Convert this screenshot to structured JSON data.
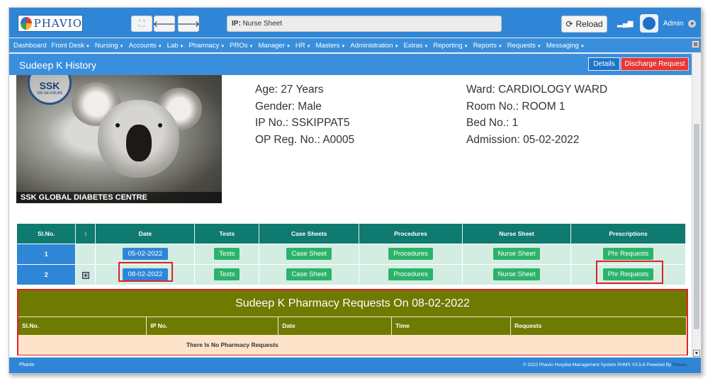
{
  "header": {
    "logo_text": "PHAVIO",
    "search_label": "IP:",
    "search_value": "Nurse Sheet",
    "reload_label": "Reload",
    "user_name": "Admin"
  },
  "menu": [
    {
      "label": "Dashboard",
      "caret": false
    },
    {
      "label": "Front Desk",
      "caret": true
    },
    {
      "label": "Nursing",
      "caret": true
    },
    {
      "label": "Accounts",
      "caret": true
    },
    {
      "label": "Lab",
      "caret": true
    },
    {
      "label": "Pharmacy",
      "caret": true
    },
    {
      "label": "PROs",
      "caret": true
    },
    {
      "label": "Manager",
      "caret": true
    },
    {
      "label": "HR",
      "caret": true
    },
    {
      "label": "Masters",
      "caret": true
    },
    {
      "label": "Administration",
      "caret": true
    },
    {
      "label": "Extras",
      "caret": true
    },
    {
      "label": "Reporting",
      "caret": true
    },
    {
      "label": "Reports",
      "caret": true
    },
    {
      "label": "Requests",
      "caret": true
    },
    {
      "label": "Messaging",
      "caret": true
    }
  ],
  "title_bar": {
    "title": "Sudeep K History",
    "details_label": "Details",
    "discharge_label": "Discharge Request"
  },
  "patient": {
    "photo_caption": "SSK GLOBAL DIABETES CENTRE",
    "seal_text": "SSK",
    "seal_subtext": "SRI SAI KRUPA",
    "age": "Age: 27 Years",
    "gender": "Gender: Male",
    "ip_no": "IP No.: SSKIPPAT5",
    "op_reg": "OP Reg. No.: A0005",
    "ward": "Ward: CARDIOLOGY WARD",
    "room": "Room No.: ROOM 1",
    "bed": "Bed No.: 1",
    "admission": "Admission: 05-02-2022"
  },
  "history_table": {
    "headers": {
      "slno": "Sl.No.",
      "sort": "↕",
      "date": "Date",
      "tests": "Tests",
      "case_sheets": "Case Sheets",
      "procedures": "Procedures",
      "nurse_sheet": "Nurse Sheet",
      "prescriptions": "Prescriptions"
    },
    "rows": [
      {
        "slno": "1",
        "date": "05-02-2022",
        "tests": "Tests",
        "case_sheets": "Case Sheet",
        "procedures": "Procedures",
        "nurse_sheet": "Nurse Sheet",
        "prescriptions": "Phr Requests"
      },
      {
        "slno": "2",
        "date": "08-02-2022",
        "tests": "Tests",
        "case_sheets": "Case Sheet",
        "procedures": "Procedures",
        "nurse_sheet": "Nurse Sheet",
        "prescriptions": "Phr Requests"
      }
    ]
  },
  "pharmacy_panel": {
    "title": "Sudeep K Pharmacy Requests On 08-02-2022",
    "headers": {
      "slno": "Sl.No.",
      "ip_no": "IP No.",
      "date": "Date",
      "time": "Time",
      "requests": "Requests"
    },
    "empty_message": "There Is No Pharmacy Requests"
  },
  "footer": {
    "left": "Phavio",
    "right_text": "© 2022 Phavio Hospital Management System PHMS V3.5.6 Powered By",
    "right_brand": "Phavio"
  },
  "colors": {
    "primary": "#2f86d6",
    "table_header": "#0f7a6f",
    "row_bg": "#d3ede2",
    "action_green": "#2cb36a",
    "olive": "#6f7a00",
    "empty_row": "#fde3c9",
    "danger": "#e53935",
    "highlight": "#e0202a"
  }
}
